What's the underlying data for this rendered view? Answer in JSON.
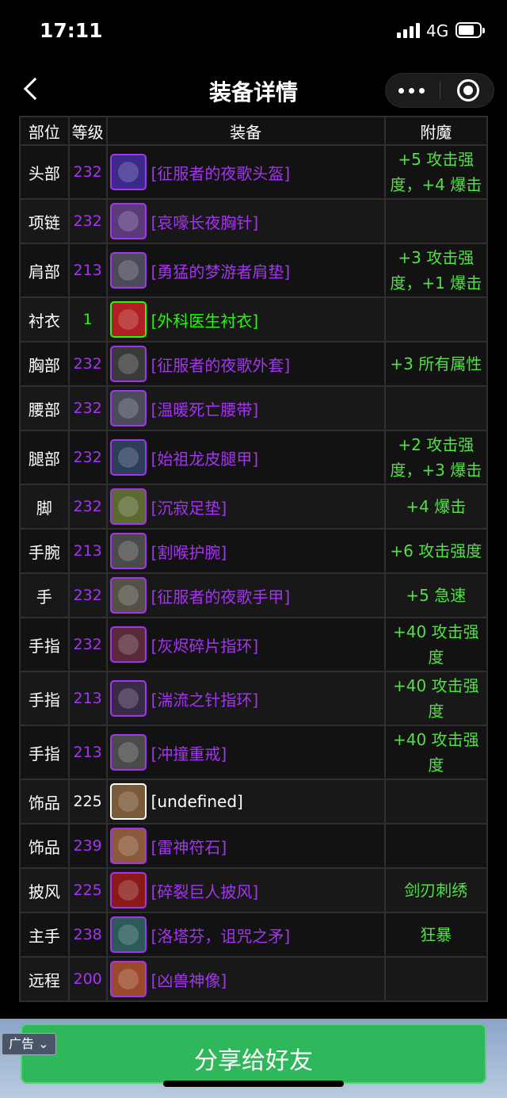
{
  "status_bar": {
    "time": "17:11",
    "network": "4G"
  },
  "nav": {
    "title": "装备详情"
  },
  "table": {
    "headers": {
      "slot": "部位",
      "level": "等级",
      "item": "装备",
      "enchant": "附魔"
    },
    "rows": [
      {
        "slot": "头部",
        "level": "232",
        "item": "[征服者的夜歌头盔]",
        "enchant": "+5 攻击强度，+4 爆击",
        "quality_color": "#a335ee",
        "icon_color": "#3b2a8c"
      },
      {
        "slot": "项链",
        "level": "232",
        "item": "[哀嚎长夜胸针]",
        "enchant": "",
        "quality_color": "#a335ee",
        "icon_color": "#5a3a7a"
      },
      {
        "slot": "肩部",
        "level": "213",
        "item": "[勇猛的梦游者肩垫]",
        "enchant": "+3 攻击强度，+1 爆击",
        "quality_color": "#a335ee",
        "icon_color": "#4a4a5a"
      },
      {
        "slot": "衬衣",
        "level": "1",
        "item": "[外科医生衬衣]",
        "enchant": "",
        "quality_color": "#1eff00",
        "icon_color": "#b02020"
      },
      {
        "slot": "胸部",
        "level": "232",
        "item": "[征服者的夜歌外套]",
        "enchant": "+3 所有属性",
        "quality_color": "#a335ee",
        "icon_color": "#3a3a3a"
      },
      {
        "slot": "腰部",
        "level": "232",
        "item": "[温暖死亡腰带]",
        "enchant": "",
        "quality_color": "#a335ee",
        "icon_color": "#4a4c5c"
      },
      {
        "slot": "腿部",
        "level": "232",
        "item": "[始祖龙皮腿甲]",
        "enchant": "+2 攻击强度，+3 爆击",
        "quality_color": "#a335ee",
        "icon_color": "#2c3e5a"
      },
      {
        "slot": "脚",
        "level": "232",
        "item": "[沉寂足垫]",
        "enchant": "+4 爆击",
        "quality_color": "#a335ee",
        "icon_color": "#5a6a30"
      },
      {
        "slot": "手腕",
        "level": "213",
        "item": "[割喉护腕]",
        "enchant": "+6 攻击强度",
        "quality_color": "#a335ee",
        "icon_color": "#4a4a4a"
      },
      {
        "slot": "手",
        "level": "232",
        "item": "[征服者的夜歌手甲]",
        "enchant": "+5 急速",
        "quality_color": "#a335ee",
        "icon_color": "#555045"
      },
      {
        "slot": "手指",
        "level": "232",
        "item": "[灰烬碎片指环]",
        "enchant": "+40 攻击强度",
        "quality_color": "#a335ee",
        "icon_color": "#5a2a3a"
      },
      {
        "slot": "手指",
        "level": "213",
        "item": "[湍流之针指环]",
        "enchant": "+40 攻击强度",
        "quality_color": "#a335ee",
        "icon_color": "#3a2a4a"
      },
      {
        "slot": "手指",
        "level": "213",
        "item": "[冲撞重戒]",
        "enchant": "+40 攻击强度",
        "quality_color": "#a335ee",
        "icon_color": "#4a4a4a"
      },
      {
        "slot": "饰品",
        "level": "225",
        "item": "[undefined]",
        "enchant": "",
        "quality_color": "#ffffff",
        "icon_color": "#7a5a3a"
      },
      {
        "slot": "饰品",
        "level": "239",
        "item": "[雷神符石]",
        "enchant": "",
        "quality_color": "#a335ee",
        "icon_color": "#8a5a3a"
      },
      {
        "slot": "披风",
        "level": "225",
        "item": "[碎裂巨人披风]",
        "enchant": "剑刃刺绣",
        "quality_color": "#a335ee",
        "icon_color": "#8a1a1a"
      },
      {
        "slot": "主手",
        "level": "238",
        "item": "[洛塔芬，诅咒之矛]",
        "enchant": "狂暴",
        "quality_color": "#a335ee",
        "icon_color": "#2a5a5a"
      },
      {
        "slot": "远程",
        "level": "200",
        "item": "[凶兽神像]",
        "enchant": "",
        "quality_color": "#a335ee",
        "icon_color": "#9a4a2a"
      }
    ]
  },
  "footer": {
    "ad_label": "广告",
    "share_label": "分享给好友"
  },
  "colors": {
    "epic": "#a335ee",
    "uncommon": "#1eff00",
    "enchant": "#52e046",
    "share_button": "#2fb85b"
  }
}
